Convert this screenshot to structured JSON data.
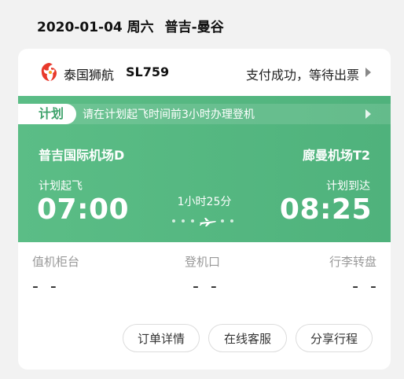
{
  "header": {
    "date": "2020-01-04",
    "weekday": "周六",
    "route": "普吉-曼谷"
  },
  "airline": {
    "name": "泰国狮航",
    "flight_no": "SL759",
    "logo_icon": "lion-logo-icon",
    "logo_color": "#e8392b"
  },
  "status": {
    "text": "支付成功，等待出票"
  },
  "notice": {
    "badge": "计划",
    "text": "请在计划起飞时间前3小时办理登机"
  },
  "flight": {
    "departure_airport": "普吉国际机场D",
    "arrival_airport": "廊曼机场T2",
    "departure_label": "计划起飞",
    "arrival_label": "计划到达",
    "departure_time": "07:00",
    "arrival_time": "08:25",
    "duration": "1小时25分"
  },
  "info": {
    "checkin_label": "值机柜台",
    "checkin_value": "- -",
    "gate_label": "登机口",
    "gate_value": "- -",
    "baggage_label": "行李转盘",
    "baggage_value": "- -"
  },
  "actions": {
    "order_details": "订单详情",
    "customer_service": "在线客服",
    "share_itinerary": "分享行程"
  },
  "colors": {
    "accent_green": "#4fb27c",
    "background": "#f2f2f2"
  }
}
